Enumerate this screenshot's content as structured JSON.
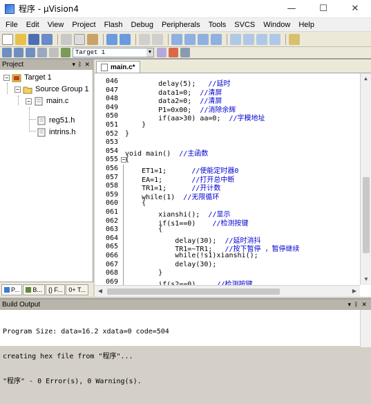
{
  "window": {
    "title": "程序 - µVision4",
    "controls": [
      "—",
      "☐",
      "✕"
    ]
  },
  "menubar": [
    "File",
    "Edit",
    "View",
    "Project",
    "Flash",
    "Debug",
    "Peripherals",
    "Tools",
    "SVCS",
    "Window",
    "Help"
  ],
  "toolbar2": {
    "target_value": "Target 1"
  },
  "project_panel": {
    "title": "Project",
    "tree": {
      "target": "Target 1",
      "group": "Source Group 1",
      "file": "main.c",
      "includes": [
        "reg51.h",
        "intrins.h"
      ]
    },
    "tabs": [
      "P...",
      "B...",
      "{} F...",
      "0+ T..."
    ]
  },
  "editor": {
    "tab_label": "main.c*",
    "lines": [
      {
        "num": "046",
        "code": "        delay(5);   //延时"
      },
      {
        "num": "047",
        "code": "        data1=0;  //清屏"
      },
      {
        "num": "048",
        "code": "        data2=0;  //清屏"
      },
      {
        "num": "049",
        "code": "        P1=0x00;  //消除余辉"
      },
      {
        "num": "050",
        "code": "        if(aa>30) aa=0;  //字模地址"
      },
      {
        "num": "051",
        "code": "    }"
      },
      {
        "num": "052",
        "code": "}"
      },
      {
        "num": "053",
        "code": ""
      },
      {
        "num": "054",
        "code": "void main()  //主函数"
      },
      {
        "num": "055",
        "code": "{"
      },
      {
        "num": "056",
        "code": "    ET1=1;      //使能定时器0"
      },
      {
        "num": "057",
        "code": "    EA=1;       //打开总中断"
      },
      {
        "num": "058",
        "code": "    TR1=1;      //开计数"
      },
      {
        "num": "059",
        "code": "    while(1)  //无限循环"
      },
      {
        "num": "060",
        "code": "    {"
      },
      {
        "num": "061",
        "code": "        xianshi();  //显示"
      },
      {
        "num": "062",
        "code": "        if(s1==0)    //检测按键"
      },
      {
        "num": "063",
        "code": "        {"
      },
      {
        "num": "064",
        "code": "            delay(30);  //延时消抖"
      },
      {
        "num": "065",
        "code": "            TR1=~TR1;   //按下暂停 ，暂停继续"
      },
      {
        "num": "066",
        "code": "            while(!s1)xianshi();"
      },
      {
        "num": "067",
        "code": "            delay(30);"
      },
      {
        "num": "068",
        "code": "        }"
      },
      {
        "num": "069",
        "code": "        if(s2==0)     //检测按键"
      }
    ]
  },
  "build_output": {
    "title": "Build Output",
    "lines": [
      "Program Size: data=16.2 xdata=0 code=504",
      "creating hex file from \"程序\"...",
      "\"程序\" - 0 Error(s), 0 Warning(s)."
    ]
  }
}
